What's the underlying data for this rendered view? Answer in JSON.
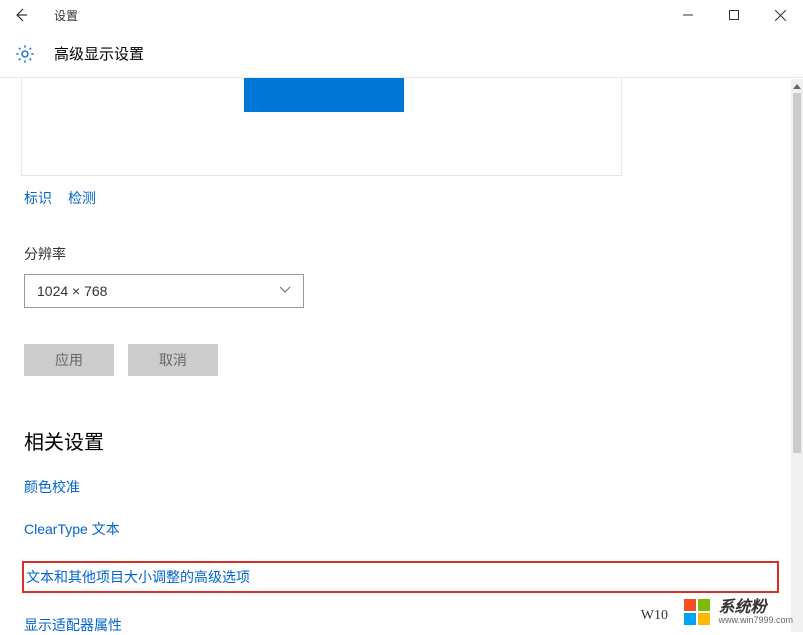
{
  "window": {
    "title": "设置",
    "back_label": "←"
  },
  "header": {
    "title": "高级显示设置"
  },
  "identify_link": "标识",
  "detect_link": "检测",
  "resolution": {
    "label": "分辨率",
    "selected": "1024 × 768"
  },
  "apply_button": "应用",
  "cancel_button": "取消",
  "related": {
    "heading": "相关设置",
    "links": {
      "color_cal": "颜色校准",
      "cleartype": "ClearType 文本",
      "text_scaling": "文本和其他项目大小调整的高级选项",
      "adapter": "显示适配器属性"
    }
  },
  "watermark": {
    "main": "系统粉",
    "url": "www.win7999.com",
    "bottom": "W10"
  }
}
